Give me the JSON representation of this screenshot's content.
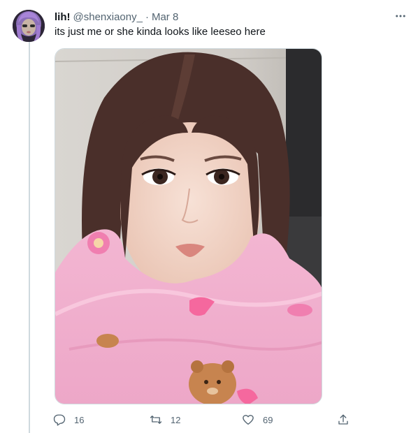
{
  "tweet": {
    "display_name": "lih!",
    "handle": "@shenxiaony_",
    "separator": "·",
    "date": "Mar 8",
    "text": "its just me or she kinda looks like leeseo here"
  },
  "media": {
    "type": "photo"
  },
  "actions": {
    "reply_count": "16",
    "retweet_count": "12",
    "like_count": "69"
  },
  "icons": {
    "reply": "reply-icon",
    "retweet": "retweet-icon",
    "like": "heart-icon",
    "share": "share-icon",
    "more": "more-icon"
  },
  "colors": {
    "text_primary": "#0f1419",
    "text_secondary": "#536471",
    "border": "#cfd9de"
  }
}
